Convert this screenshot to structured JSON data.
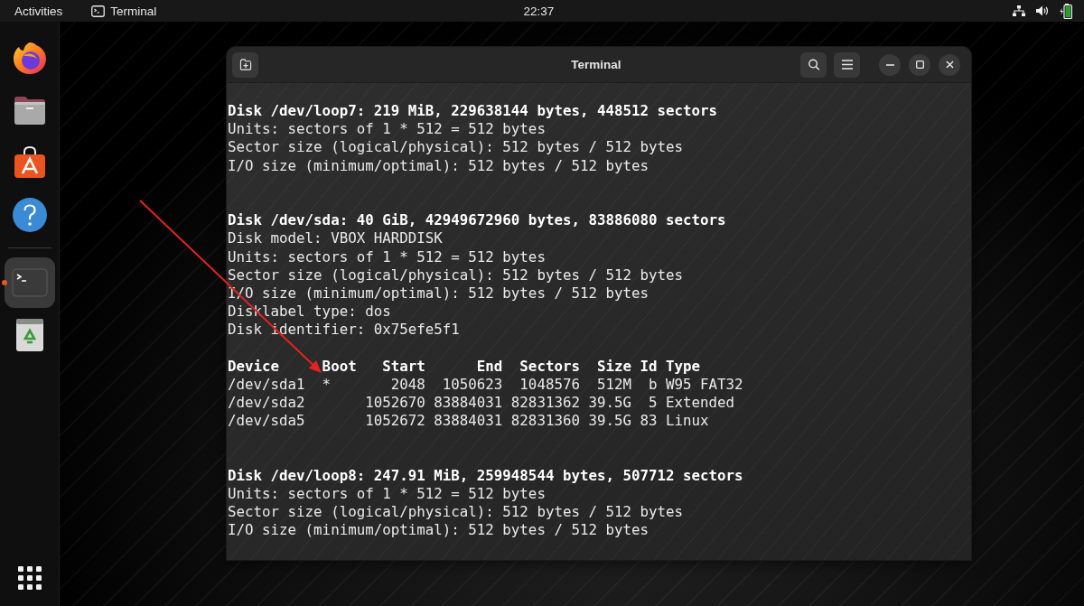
{
  "top_bar": {
    "activities": "Activities",
    "app_menu": {
      "label": "Terminal"
    },
    "clock": "22:37"
  },
  "dock": {
    "favorites": [
      {
        "kind": "browser",
        "selected": false,
        "running": false
      },
      {
        "kind": "files",
        "selected": false,
        "running": false
      },
      {
        "kind": "software",
        "selected": false,
        "running": false
      },
      {
        "kind": "help",
        "selected": false,
        "running": false
      }
    ],
    "others": [
      {
        "kind": "terminal",
        "selected": true,
        "running": true
      },
      {
        "kind": "trash",
        "selected": false,
        "running": false
      }
    ]
  },
  "window": {
    "title": "Terminal"
  },
  "terminal": {
    "lines": [
      {
        "kind": "heading",
        "text": "Disk /dev/loop7: 219 MiB, 229638144 bytes, 448512 sectors"
      },
      {
        "kind": "text",
        "text": "Units: sectors of 1 * 512 = 512 bytes"
      },
      {
        "kind": "text",
        "text": "Sector size (logical/physical): 512 bytes / 512 bytes"
      },
      {
        "kind": "text",
        "text": "I/O size (minimum/optimal): 512 bytes / 512 bytes"
      },
      {
        "kind": "blank"
      },
      {
        "kind": "blank"
      },
      {
        "kind": "heading",
        "text": "Disk /dev/sda: 40 GiB, 42949672960 bytes, 83886080 sectors"
      },
      {
        "kind": "text",
        "text": "Disk model: VBOX HARDDISK"
      },
      {
        "kind": "text",
        "text": "Units: sectors of 1 * 512 = 512 bytes"
      },
      {
        "kind": "text",
        "text": "Sector size (logical/physical): 512 bytes / 512 bytes"
      },
      {
        "kind": "text",
        "text": "I/O size (minimum/optimal): 512 bytes / 512 bytes"
      },
      {
        "kind": "text",
        "text": "Disklabel type: dos"
      },
      {
        "kind": "text",
        "text": "Disk identifier: 0x75efe5f1"
      },
      {
        "kind": "blank"
      },
      {
        "kind": "heading",
        "text": "Device     Boot   Start      End  Sectors  Size Id Type"
      },
      {
        "kind": "text",
        "text": "/dev/sda1  *       2048  1050623  1048576  512M  b W95 FAT32"
      },
      {
        "kind": "text",
        "text": "/dev/sda2       1052670 83884031 82831362 39.5G  5 Extended"
      },
      {
        "kind": "text",
        "text": "/dev/sda5       1052672 83884031 82831360 39.5G 83 Linux"
      },
      {
        "kind": "blank"
      },
      {
        "kind": "blank"
      },
      {
        "kind": "heading",
        "text": "Disk /dev/loop8: 247.91 MiB, 259948544 bytes, 507712 sectors"
      },
      {
        "kind": "text",
        "text": "Units: sectors of 1 * 512 = 512 bytes"
      },
      {
        "kind": "text",
        "text": "Sector size (logical/physical): 512 bytes / 512 bytes"
      },
      {
        "kind": "text",
        "text": "I/O size (minimum/optimal): 512 bytes / 512 bytes"
      }
    ]
  },
  "annotations": [
    {
      "kind": "arrow"
    }
  ]
}
